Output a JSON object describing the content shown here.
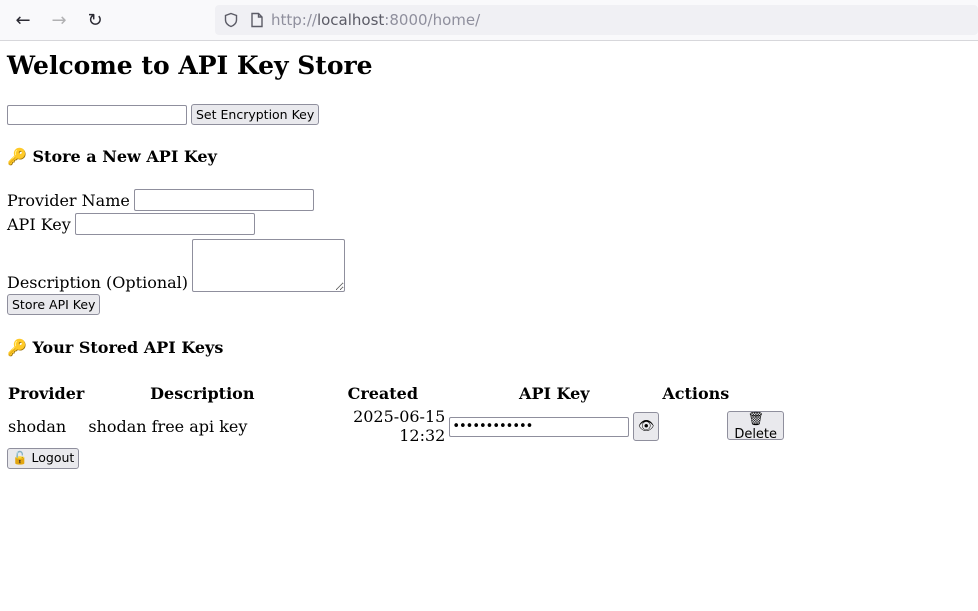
{
  "browser": {
    "back_icon": "←",
    "forward_icon": "→",
    "reload_icon": "↻",
    "url_prefix": "http://",
    "url_host": "localhost",
    "url_rest": ":8000/home/"
  },
  "page": {
    "title": "Welcome to API Key Store",
    "set_key_button": "Set Encryption Key",
    "encryption_key_value": ""
  },
  "store_form": {
    "heading": "🔑 Store a New API Key",
    "provider_label": "Provider Name",
    "api_key_label": "API Key",
    "description_label": "Description (Optional)",
    "submit_button": "Store API Key"
  },
  "stored_keys": {
    "heading": "🔑 Your Stored API Keys",
    "columns": [
      "Provider",
      "Description",
      "Created",
      "API Key",
      "Actions"
    ],
    "rows": [
      {
        "provider": "shodan",
        "description": "shodan free api key",
        "created": "2025-06-15 12:32",
        "api_key_masked": "••••••••••••",
        "show_button": "👁",
        "delete_button": "🗑 Delete"
      }
    ]
  },
  "logout_button": "🔓 Logout"
}
